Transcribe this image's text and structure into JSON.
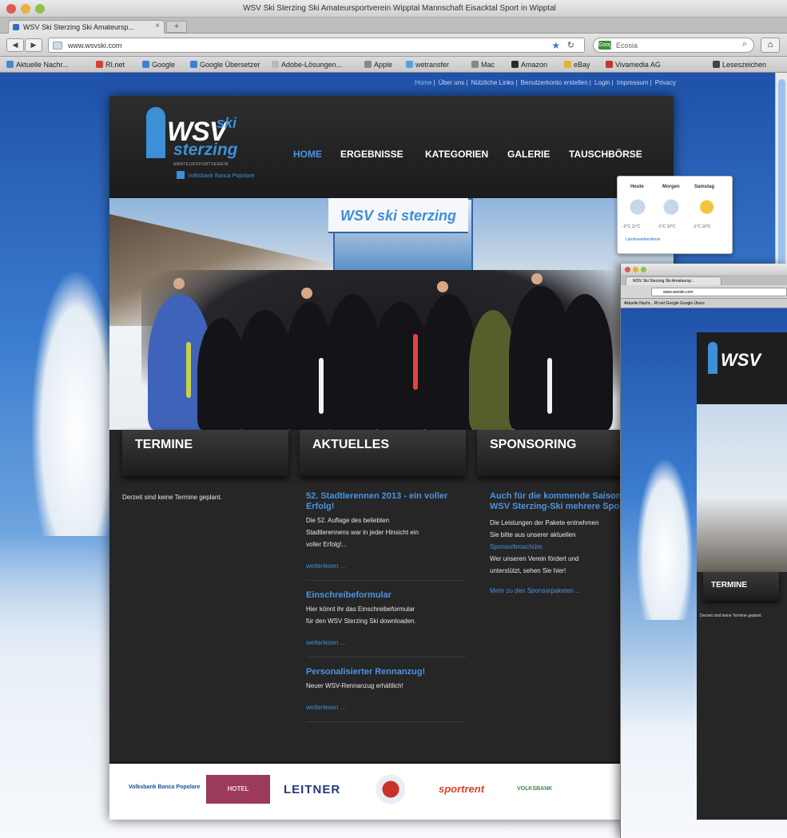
{
  "browser": {
    "window_title": "WSV Ski Sterzing Ski Amateursportverein Wipptal Mannschaft Eisacktal Sport in Wipptal",
    "tab_label": "WSV Ski Sterzing Ski Amateursp...",
    "tab_close": "×",
    "new_tab": "+",
    "back": "◀",
    "forward": "▶",
    "url": "www.wsvski.com",
    "search_engine": "Google",
    "search_placeholder": "Ecosia",
    "home_icon": "⌂",
    "bookmarks": [
      "Aktuelle Nachr...",
      "RI.net",
      "Google",
      "Google Übersetzer",
      "Adobe-Lösungen...",
      "Apple",
      "wetransfer",
      "Mac",
      "Amazon",
      "eBay",
      "Vivamedia AG",
      "Leseszeichen"
    ]
  },
  "site": {
    "top_links": [
      "Home",
      "Über uns",
      "Nützliche Links",
      "Benutzerkonto erstellen",
      "Login",
      "Impressum",
      "Privacy"
    ],
    "logo": {
      "wsv": "WSV",
      "ski": "ski",
      "sterzing": "sterzing",
      "subtitle": "AMATEURSPORTVEREIN",
      "sponsor": "Volksbank Banca Popolare"
    },
    "nav": [
      {
        "label": "HOME",
        "active": true
      },
      {
        "label": "ERGEBNISSE",
        "active": false
      },
      {
        "label": "KATEGORIEN",
        "active": false
      },
      {
        "label": "GALERIE",
        "active": false
      },
      {
        "label": "TAUSCHBÖRSE",
        "active": false
      }
    ],
    "hero_banner": "WSV ski sterzing",
    "sections": {
      "termine": {
        "heading": "TERMINE",
        "text": "Derzeit sind keine Termine geplant."
      },
      "aktuelles": {
        "heading": "AKTUELLES",
        "items": [
          {
            "title": "52. Stadtlerennen 2013 - ein voller Erfolg!",
            "lines": [
              "Die 52. Auflage des beliebten",
              "Stadtlerennens war in jeder Hinsicht ein",
              "voller Erfolg!..."
            ],
            "more": "weiterlesen ..."
          },
          {
            "title": "Einschreibeformular",
            "lines": [
              "Hier könnt ihr das Einschreibeformular",
              "für den WSV Sterzing Ski downloaden."
            ],
            "more": "weiterlesen ..."
          },
          {
            "title": "Personalisierter Rennanzug!",
            "lines": [
              "Neuer WSV-Rennanzug erhältlich!"
            ],
            "more": "weiterlesen ..."
          }
        ]
      },
      "sponsoring": {
        "heading": "SPONSORING",
        "title": "Auch für die kommende Saison bietet der WSV Sterzing-Ski mehrere Sponsorpakete",
        "lines": [
          "Die Leistungen der Pakete entnehmen",
          "Sie bitte aus unserer aktuellen",
          "Sponsorbroschüre."
        ],
        "line4": "Wer unseren Verein fördert und",
        "line5": "unterstützt, sehen Sie hier!",
        "link": "Mehr zu den Sponsorpaketen ..."
      }
    },
    "sponsors": [
      "Volksbank Banca Popolare",
      "HOTEL",
      "LEITNER",
      "sportrent",
      "VOLKSBANK"
    ]
  },
  "weather": {
    "days": [
      "Heute",
      "Morgen",
      "Samstag"
    ],
    "temps": [
      "-2°C  11°C",
      "-1°C  10°C",
      "-1°C  10°C"
    ],
    "link": "Landeswetterdienst"
  },
  "window2": {
    "tab_label": "WSV Ski Sterzing Ski Amateursp...",
    "url": "www.wsvski.com",
    "bookmarks": "Aktuelle Nachr...   RI.net   Google   Google Übers",
    "logo": "WSV",
    "termine": "TERMINE",
    "text": "Derzeit sind keine Termine geplant."
  },
  "colors": {
    "accent": "#4a94e0",
    "site_bg": "#262626",
    "sky": "#3b7dd0"
  }
}
